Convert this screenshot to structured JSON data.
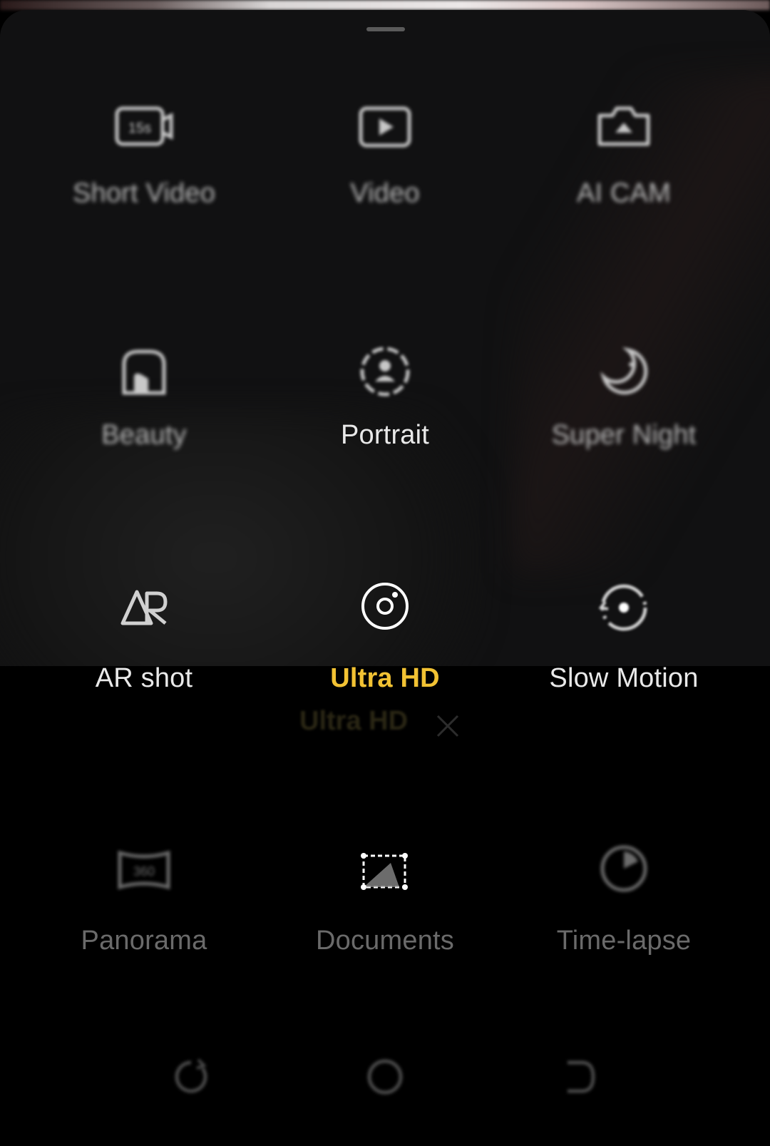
{
  "sheet": {
    "modes_row1": [
      {
        "label": "Short Video",
        "icon": "short-video-icon"
      },
      {
        "label": "Video",
        "icon": "video-icon"
      },
      {
        "label": "AI CAM",
        "icon": "ai-cam-icon"
      }
    ],
    "modes_row2": [
      {
        "label": "Beauty",
        "icon": "beauty-icon"
      },
      {
        "label": "Portrait",
        "icon": "portrait-icon"
      },
      {
        "label": "Super Night",
        "icon": "moon-icon"
      }
    ],
    "modes_row3": [
      {
        "label": "AR shot",
        "icon": "ar-icon"
      },
      {
        "label": "Ultra HD",
        "icon": "ultra-hd-icon"
      },
      {
        "label": "Slow Motion",
        "icon": "slow-motion-icon"
      }
    ],
    "modes_row4": [
      {
        "label": "Panorama",
        "icon": "panorama-icon"
      },
      {
        "label": "Documents",
        "icon": "documents-icon"
      },
      {
        "label": "Time-lapse",
        "icon": "timelapse-icon"
      }
    ]
  },
  "current_mode_tag": {
    "label": "Ultra HD"
  },
  "colors": {
    "active": "#f2c233",
    "text": "#e9e9e9",
    "sheet_bg": "#111112"
  },
  "navbar": {
    "items": [
      "recent-apps-icon",
      "home-icon",
      "back-icon"
    ]
  }
}
